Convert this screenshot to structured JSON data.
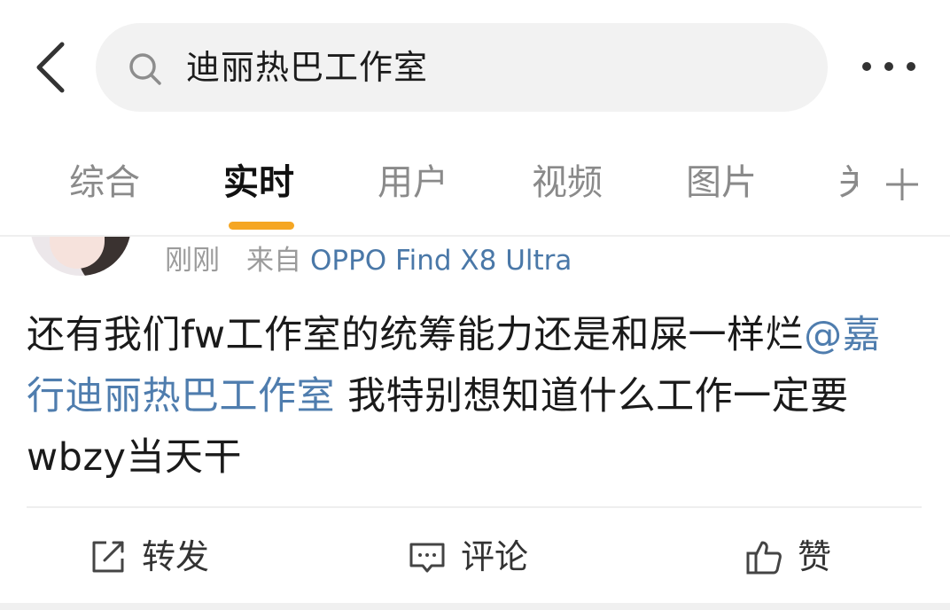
{
  "search": {
    "query": "迪丽热巴工作室"
  },
  "tabs": [
    {
      "label": "综合"
    },
    {
      "label": "实时"
    },
    {
      "label": "用户"
    },
    {
      "label": "视频"
    },
    {
      "label": "图片"
    },
    {
      "label": "关"
    }
  ],
  "active_tab": "实时",
  "post": {
    "time": "刚刚",
    "source_prefix": "来自",
    "device": "OPPO Find X8 Ultra",
    "text_part1": "还有我们fw工作室的统筹能力还是和屎一样烂",
    "mention": "@嘉行迪丽热巴工作室",
    "text_part2": " 我特别想知道什么工作一定要wbzy当天干"
  },
  "actions": {
    "repost_label": "转发",
    "comment_label": "评论",
    "like_label": "赞"
  },
  "colors": {
    "accent_indicator": "#f5a623",
    "link": "#4f7dae",
    "device_link": "#4a78a8",
    "muted_text": "#9b9b9b"
  },
  "icons": [
    "back-chevron-icon",
    "search-icon",
    "more-dots-icon",
    "plus-icon",
    "repost-icon",
    "comment-icon",
    "like-icon"
  ]
}
